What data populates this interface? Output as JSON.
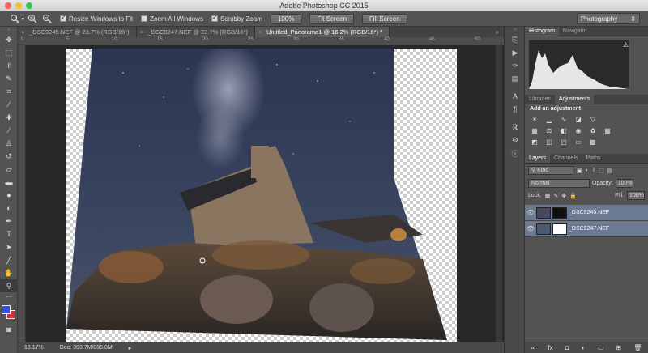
{
  "app": {
    "title": "Adobe Photoshop CC 2015",
    "workspace": "Photography"
  },
  "options": {
    "resize_windows": "Resize Windows to Fit",
    "zoom_all": "Zoom All Windows",
    "scrubby_zoom": "Scrubby Zoom",
    "zoom_100": "100%",
    "fit_screen": "Fit Screen",
    "fill_screen": "Fill Screen"
  },
  "tabs": [
    {
      "label": "_DSC9245.NEF @ 23.7% (RGB/16*)"
    },
    {
      "label": "_DSC9247.NEF @ 23.7% (RGB/16*)"
    },
    {
      "label": "Untitled_Panorama1 @ 16.2% (RGB/16*) *"
    }
  ],
  "ruler": {
    "top": [
      "0",
      "5",
      "10",
      "15",
      "20",
      "25",
      "30",
      "35",
      "40",
      "45",
      "50"
    ]
  },
  "status": {
    "zoom": "16.17%",
    "doc": "Doc: 393.7M/885.0M"
  },
  "histogram": {
    "tab1": "Histogram",
    "tab2": "Navigator"
  },
  "adjustments": {
    "tab1": "Libraries",
    "tab2": "Adjustments",
    "heading": "Add an adjustment"
  },
  "layers": {
    "tabs": [
      "Layers",
      "Channels",
      "Paths"
    ],
    "filter": "Kind",
    "blend": "Normal",
    "opacity_label": "Opacity:",
    "opacity": "100%",
    "lock_label": "Lock:",
    "fill_label": "Fill:",
    "fill": "100%",
    "items": [
      {
        "name": "_DSC9245.NEF"
      },
      {
        "name": "_DSC9247.NEF"
      }
    ]
  },
  "colors": {
    "foreground": "#3a4fd8",
    "background": "#d42a3c"
  }
}
